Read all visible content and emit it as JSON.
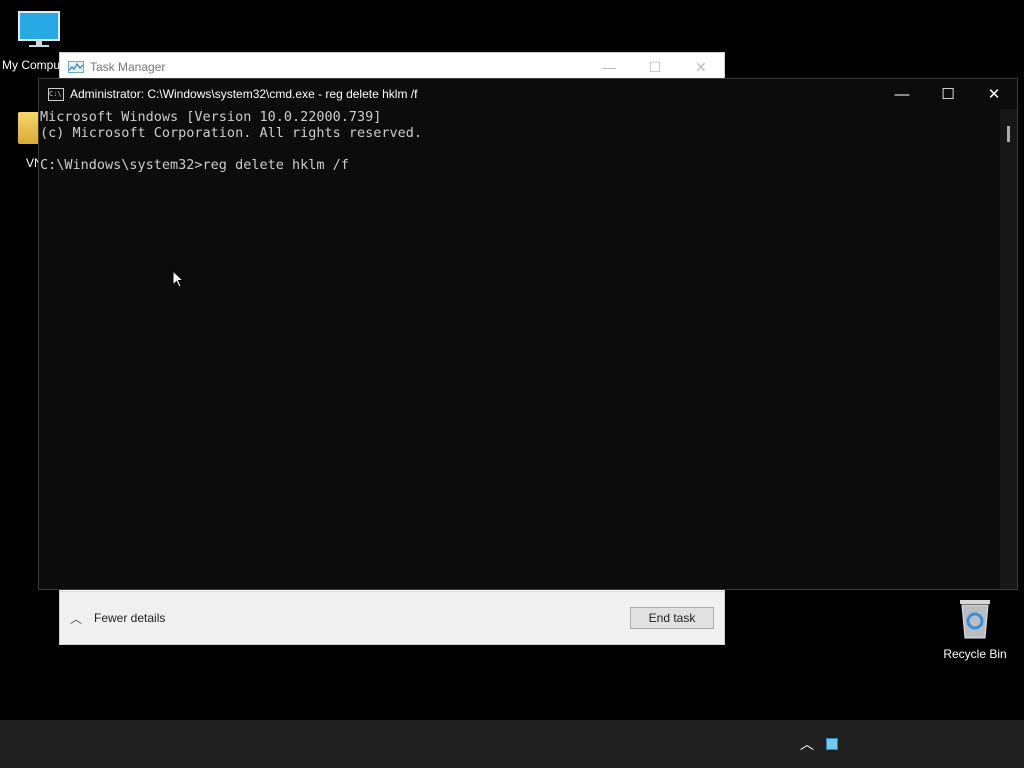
{
  "desktop": {
    "my_computer_label": "My Compu",
    "folder_label": "VN",
    "recycle_bin_label": "Recycle Bin"
  },
  "task_manager": {
    "title": "Task Manager",
    "fewer_details": "Fewer details",
    "end_task": "End task"
  },
  "cmd": {
    "title": "Administrator: C:\\Windows\\system32\\cmd.exe - reg  delete hklm /f",
    "icon_text": "C:\\",
    "lines": [
      "Microsoft Windows [Version 10.0.22000.739]",
      "(c) Microsoft Corporation. All rights reserved.",
      "",
      "C:\\Windows\\system32>reg delete hklm /f"
    ]
  },
  "window_controls": {
    "minimize": "—",
    "maximize": "☐",
    "close": "✕"
  },
  "taskbar": {
    "tray_chevron": "︿"
  }
}
